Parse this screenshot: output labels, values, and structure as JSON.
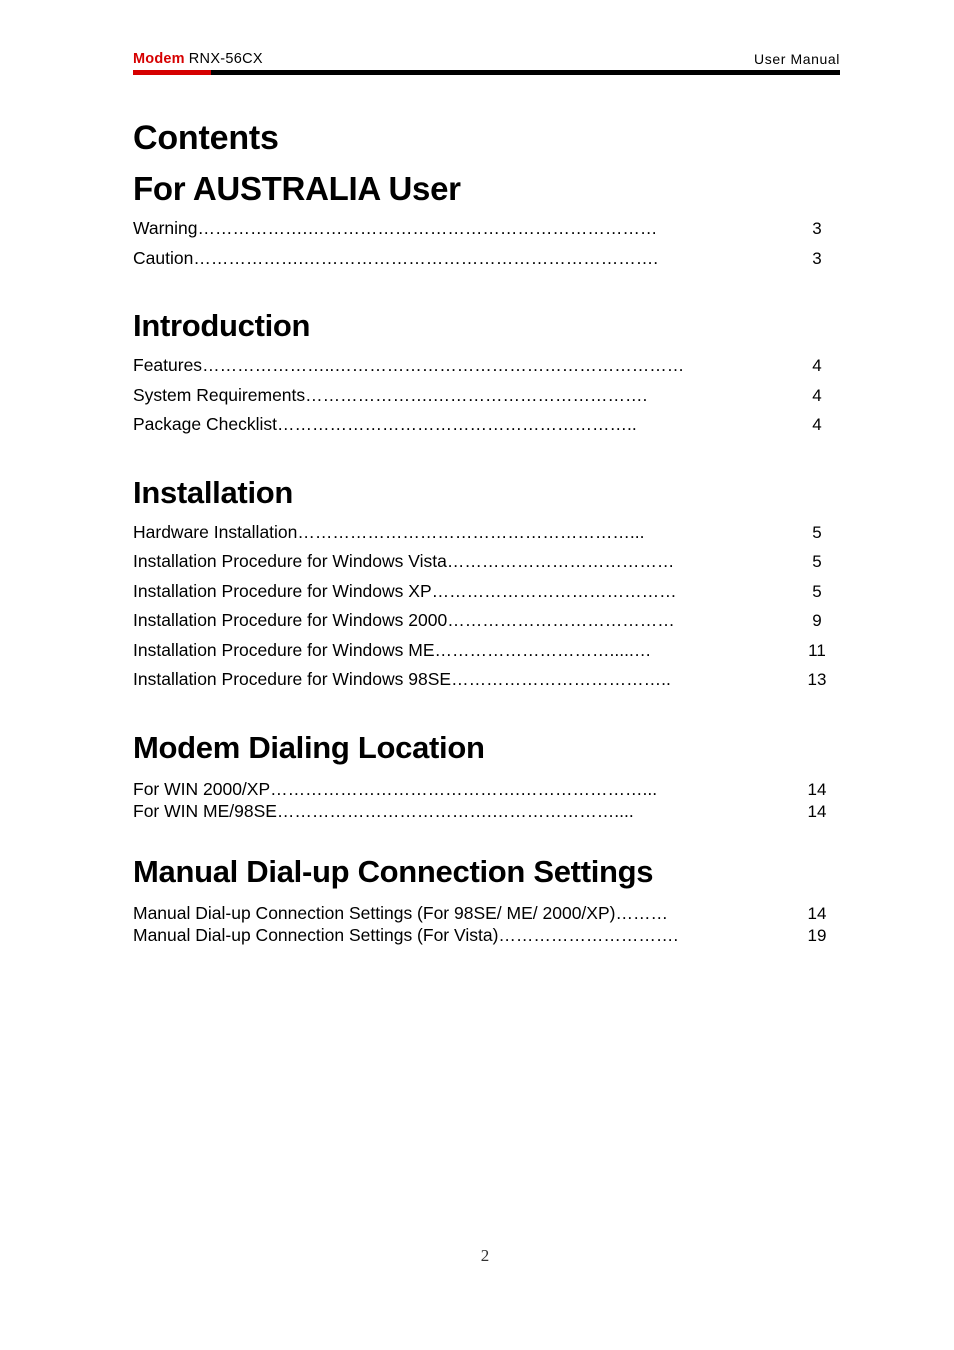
{
  "header": {
    "brand": "Modem",
    "model": "RNX-56CX",
    "doc_type": "User  Manual",
    "rule_color": "#000000",
    "rule_accent_color": "#d60000",
    "brand_color": "#d60000"
  },
  "page_title": "Contents",
  "sections": [
    {
      "heading": "For AUSTRALIA User",
      "spacing": "loose",
      "entries": [
        {
          "label": "Warning ",
          "leader": "……………….……………………………………………………",
          "page": "3"
        },
        {
          "label": "Caution………………. ",
          "leader": "…………………………………………………….",
          "page": "3"
        }
      ]
    },
    {
      "heading": "Introduction",
      "spacing": "loose",
      "entries": [
        {
          "label": "Features ",
          "leader": "…………………..……………………………………………………",
          "page": "4"
        },
        {
          "label": "System Requirements ",
          "leader": "………………….……………………………….",
          "page": "4"
        },
        {
          "label": "Package Checklist ",
          "leader": "……………………………………………………..",
          "page": "4"
        }
      ]
    },
    {
      "heading": "Installation",
      "spacing": "loose",
      "entries": [
        {
          "label": "Hardware Installation ",
          "leader": "…………………………………………………...",
          "page": "5"
        },
        {
          "label": "Installation Procedure for Windows Vista",
          "leader": "…………………………………",
          "page": "5"
        },
        {
          "label": "Installation Procedure for Windows XP ",
          "leader": "……………………………………",
          "page": "5"
        },
        {
          "label": "Installation Procedure for Windows 2000",
          "leader": "…………………………………",
          "page": "9"
        },
        {
          "label": "Installation Procedure for Windows ME ",
          "leader": "………………………….....…",
          "page": "11"
        },
        {
          "label": "Installation Procedure for Windows 98SE ",
          "leader": "………………………………..",
          "page": "13"
        }
      ]
    },
    {
      "heading": "Modem Dialing Location",
      "spacing": "tight",
      "entries": [
        {
          "label": "For WIN 2000/XP ",
          "leader": "…………………………………….…………………...",
          "page": "14"
        },
        {
          "label": "For WIN ME/98SE ",
          "leader": "……………………………….…………………....",
          "page": "14"
        }
      ]
    },
    {
      "heading": "Manual Dial-up Connection Settings",
      "spacing": "tight",
      "entries": [
        {
          "label": "Manual Dial-up Connection Settings (For 98SE/ ME/ 2000/XP) ",
          "leader": "………",
          "page": "14"
        },
        {
          "label": "Manual Dial-up Connection Settings (For Vista)",
          "leader": "………………………….",
          "page": "19"
        }
      ]
    }
  ],
  "folio": "2"
}
